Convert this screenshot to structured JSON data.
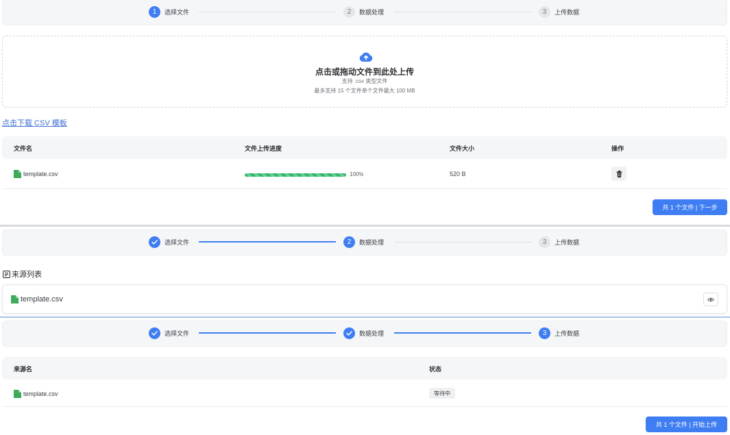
{
  "steps": [
    {
      "number": "1",
      "label": "选择文件"
    },
    {
      "number": "2",
      "label": "数据处理"
    },
    {
      "number": "3",
      "label": "上传数据"
    }
  ],
  "upload": {
    "title": "点击或拖动文件到此处上传",
    "hint_type": "支持 .csv 类型文件",
    "hint_limit": "最多支持 15 个文件单个文件最大 100 MB",
    "icon": "cloud-upload-icon"
  },
  "download_link": "点击下载 CSV 模板",
  "file_table": {
    "headers": [
      "文件名",
      "文件上传进度",
      "文件大小",
      "操作"
    ],
    "rows": [
      {
        "name": "template.csv",
        "progress": 100,
        "progress_label": "100%",
        "size": "520 B"
      }
    ]
  },
  "next_button": "共 1 个文件 | 下一步",
  "source_list": {
    "title": "来源列表",
    "items": [
      {
        "name": "template.csv"
      }
    ]
  },
  "upload_table": {
    "headers": [
      "来源名",
      "状态"
    ],
    "rows": [
      {
        "name": "template.csv",
        "status": "等待中"
      }
    ]
  },
  "start_button": "共 1 个文件 | 开始上传",
  "colors": {
    "primary": "#3f7ef2",
    "progress": "#34b36b",
    "file_icon": "#3daa5c"
  }
}
